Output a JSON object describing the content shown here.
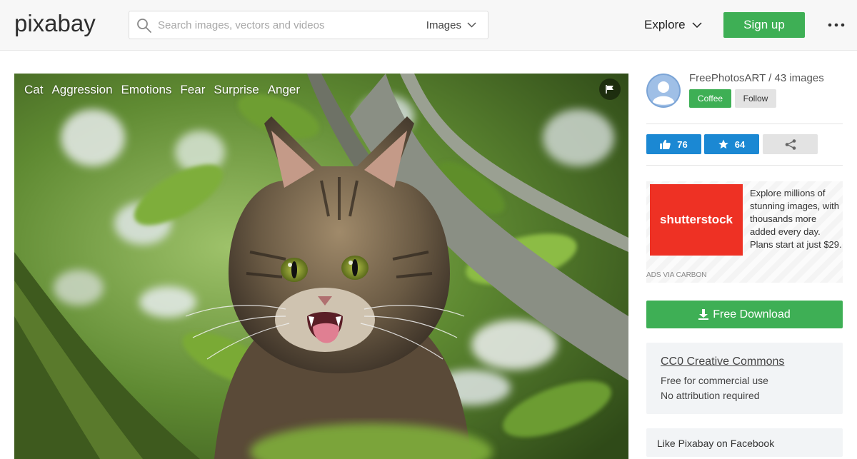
{
  "header": {
    "logo_text": "pixabay",
    "search": {
      "placeholder": "Search images, vectors and videos",
      "value": "",
      "type_label": "Images"
    },
    "explore_label": "Explore",
    "signup_label": "Sign up"
  },
  "photo": {
    "tags": [
      "Cat",
      "Aggression",
      "Emotions",
      "Fear",
      "Surprise",
      "Anger"
    ]
  },
  "sidebar": {
    "author": {
      "name_line": "FreePhotosART / 43 images",
      "coffee_label": "Coffee",
      "follow_label": "Follow"
    },
    "actions": {
      "likes": "76",
      "favorites": "64"
    },
    "ad": {
      "logo_text": "shutterstock",
      "text": "Explore millions of stunning images, with thousands more added every day. Plans start at just $29.",
      "via": "ADS VIA CARBON"
    },
    "download_label": "Free Download",
    "license": {
      "title": "CC0 Creative Commons",
      "line1": "Free for commercial use",
      "line2": "No attribution required"
    },
    "facebook_text": "Like Pixabay on Facebook"
  },
  "colors": {
    "brand_green": "#3eaf55",
    "action_blue": "#1b88d3",
    "ad_red": "#ee3124"
  }
}
